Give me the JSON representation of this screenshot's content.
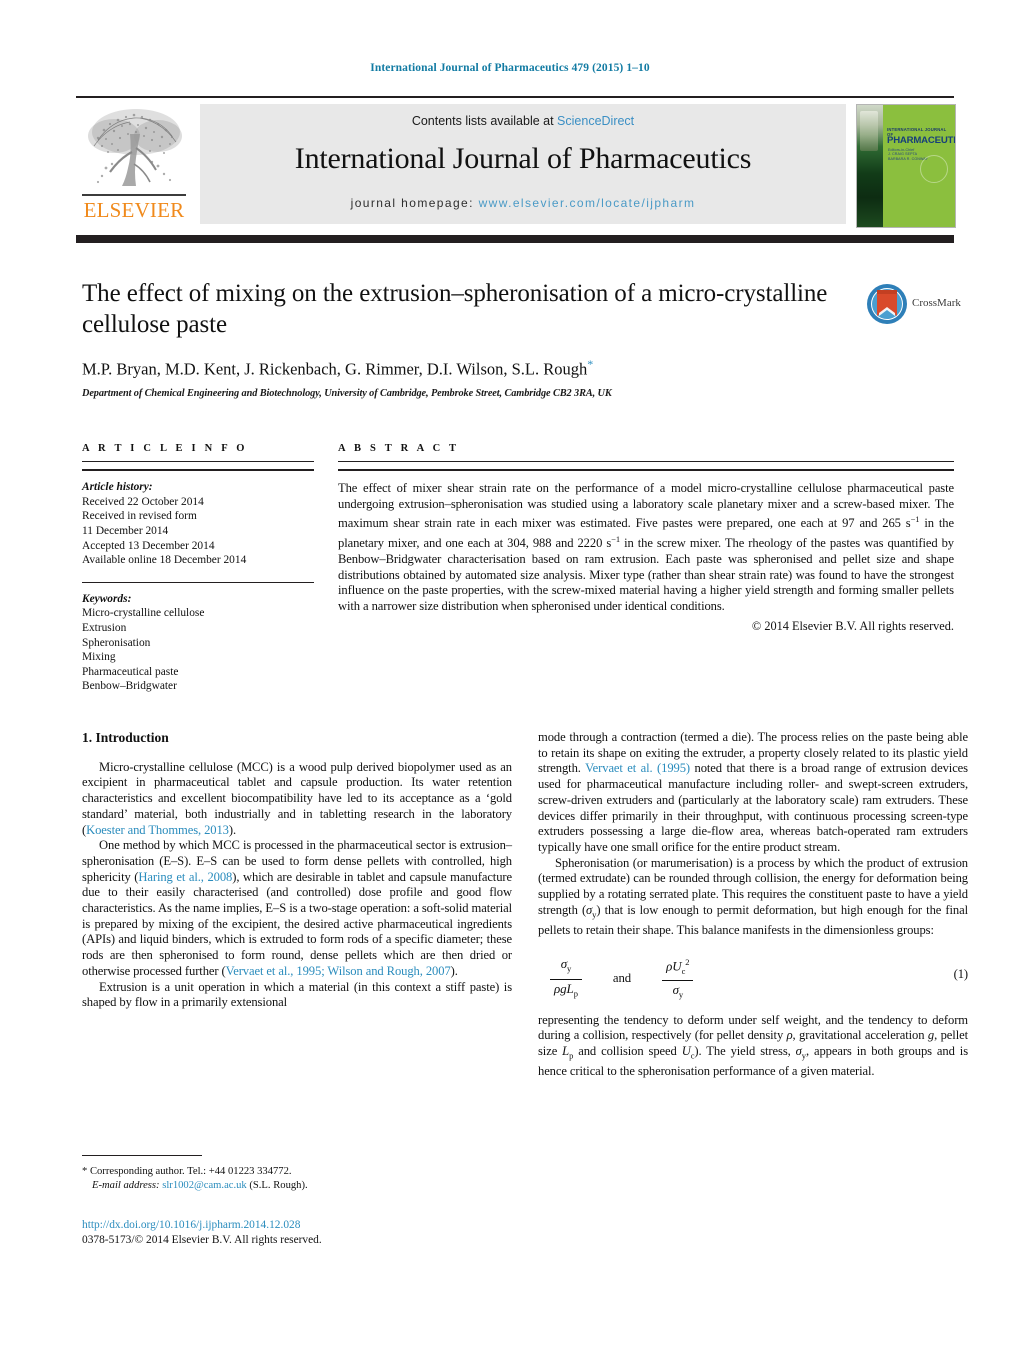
{
  "running_head": "International Journal of Pharmaceutics 479 (2015) 1–10",
  "masthead": {
    "publisher_name": "ELSEVIER",
    "contents_prefix": "Contents lists available at ",
    "sciencedirect": "ScienceDirect",
    "journal_title": "International Journal of Pharmaceutics",
    "homepage_prefix": "journal homepage: ",
    "homepage_url": "www.elsevier.com/locate/ijpharm",
    "cover": {
      "line_top": "INTERNATIONAL JOURNAL OF",
      "line_main": "PHARMACEUTICS",
      "line_sub": "Editors-in-Chief\nJ. CRAIG SEPTA\nBARBARA R. CONWAY"
    }
  },
  "article": {
    "title": "The effect of mixing on the extrusion–spheronisation of a micro-crystalline cellulose paste",
    "authors": "M.P. Bryan, M.D. Kent, J. Rickenbach, G. Rimmer, D.I. Wilson, S.L. Rough",
    "corresponding_marker": "*",
    "affiliation": "Department of Chemical Engineering and Biotechnology, University of Cambridge, Pembroke Street, Cambridge CB2 3RA, UK",
    "crossmark_label": "CrossMark"
  },
  "article_info": {
    "heading": "A R T I C L E   I N F O",
    "history_label": "Article history:",
    "history": [
      "Received 22 October 2014",
      "Received in revised form",
      "11 December 2014",
      "Accepted 13 December 2014",
      "Available online 18 December 2014"
    ],
    "keywords_label": "Keywords:",
    "keywords": [
      "Micro-crystalline cellulose",
      "Extrusion",
      "Spheronisation",
      "Mixing",
      "Pharmaceutical paste",
      "Benbow–Bridgwater"
    ]
  },
  "abstract": {
    "heading": "A B S T R A C T",
    "text": "The effect of mixer shear strain rate on the performance of a model micro-crystalline cellulose pharmaceutical paste undergoing extrusion–spheronisation was studied using a laboratory scale planetary mixer and a screw-based mixer. The maximum shear strain rate in each mixer was estimated. Five pastes were prepared, one each at 97 and 265 s−1 in the planetary mixer, and one each at 304, 988 and 2220 s−1 in the screw mixer. The rheology of the pastes was quantified by Benbow–Bridgwater characterisation based on ram extrusion. Each paste was spheronised and pellet size and shape distributions obtained by automated size analysis. Mixer type (rather than shear strain rate) was found to have the strongest influence on the paste properties, with the screw-mixed material having a higher yield strength and forming smaller pellets with a narrower size distribution when spheronised under identical conditions.",
    "copyright": "© 2014 Elsevier B.V. All rights reserved."
  },
  "body": {
    "section_heading": "1. Introduction",
    "left_paragraphs": [
      {
        "segments": [
          {
            "t": "Micro-crystalline cellulose (MCC) is a wood pulp derived biopolymer used as an excipient in pharmaceutical tablet and capsule production. Its water retention characteristics and excellent biocompatibility have led to its acceptance as a ‘gold standard’ material, both industrially and in tabletting research in the laboratory ("
          },
          {
            "t": "Koester and Thommes, 2013",
            "ref": true
          },
          {
            "t": ")."
          }
        ]
      },
      {
        "segments": [
          {
            "t": "One method by which MCC is processed in the pharmaceutical sector is extrusion–spheronisation (E–S). E–S can be used to form dense pellets with controlled, high sphericity ("
          },
          {
            "t": "Haring et al., 2008",
            "ref": true
          },
          {
            "t": "), which are desirable in tablet and capsule manufacture due to their easily characterised (and controlled) dose profile and good flow characteristics. As the name implies, E–S is a two-stage operation: a soft-solid material is prepared by mixing of the excipient, the desired active pharmaceutical ingredients (APIs) and liquid binders, which is extruded to form rods of a specific diameter; these rods are then spheronised to form round, dense pellets which are then dried or otherwise processed further ("
          },
          {
            "t": "Vervaet et al., 1995; Wilson and Rough, 2007",
            "ref": true
          },
          {
            "t": ")."
          }
        ]
      },
      {
        "segments": [
          {
            "t": "Extrusion is a unit operation in which a material (in this context a stiff paste) is shaped by flow in a primarily extensional"
          }
        ]
      }
    ],
    "right_paragraphs": [
      {
        "segments": [
          {
            "t": "mode through a contraction (termed a die). The process relies on the paste being able to retain its shape on exiting the extruder, a property closely related to its plastic yield strength. "
          },
          {
            "t": "Vervaet et al. (1995)",
            "ref": true
          },
          {
            "t": " noted that there is a broad range of extrusion devices used for pharmaceutical manufacture including roller- and swept-screen extruders, screw-driven extruders and (particularly at the laboratory scale) ram extruders. These devices differ primarily in their throughput, with continuous processing screen-type extruders possessing a large die-flow area, whereas batch-operated ram extruders typically have one small orifice for the entire product stream."
          }
        ],
        "no_indent": true
      },
      {
        "segments": [
          {
            "t": "Spheronisation (or marumerisation) is a process by which the product of extrusion (termed extrudate) can be rounded through collision, the energy for deformation being supplied by a rotating serrated plate. This requires the constituent paste to have a yield strength (σy) that is low enough to permit deformation, but high enough for the final pellets to retain their shape. This balance manifests in the dimensionless groups:"
          }
        ]
      }
    ],
    "equation": {
      "number": "(1)",
      "group1_num": "σy",
      "group1_den": "ρgLp",
      "connector": "and",
      "group2_num": "ρUc2",
      "group2_den": "σy"
    },
    "right_paragraphs_after_eq": [
      {
        "segments": [
          {
            "t": "representing the tendency to deform under self weight, and the tendency to deform during a collision, respectively (for pellet density ρ, gravitational acceleration g, pellet size Lp and collision speed Uc). The yield stress, σy, appears in both groups and is hence critical to the spheronisation performance of a given material."
          }
        ],
        "no_indent": true
      }
    ]
  },
  "footnote": {
    "star": "*",
    "corresponding": " Corresponding author. Tel.: +44 01223 334772.",
    "email_label": "E-mail address:",
    "email": "slr1002@cam.ac.uk",
    "email_suffix": " (S.L. Rough)."
  },
  "doi": {
    "url": "http://dx.doi.org/10.1016/j.ijpharm.2014.12.028",
    "issn_line": "0378-5173/© 2014 Elsevier B.V. All rights reserved."
  },
  "colors": {
    "link_blue": "#2a8cbd",
    "running_head_blue": "#127ba3",
    "elsevier_orange": "#f08a1c",
    "cover_green": "#8bbf3e",
    "rule_black": "#231f20"
  }
}
